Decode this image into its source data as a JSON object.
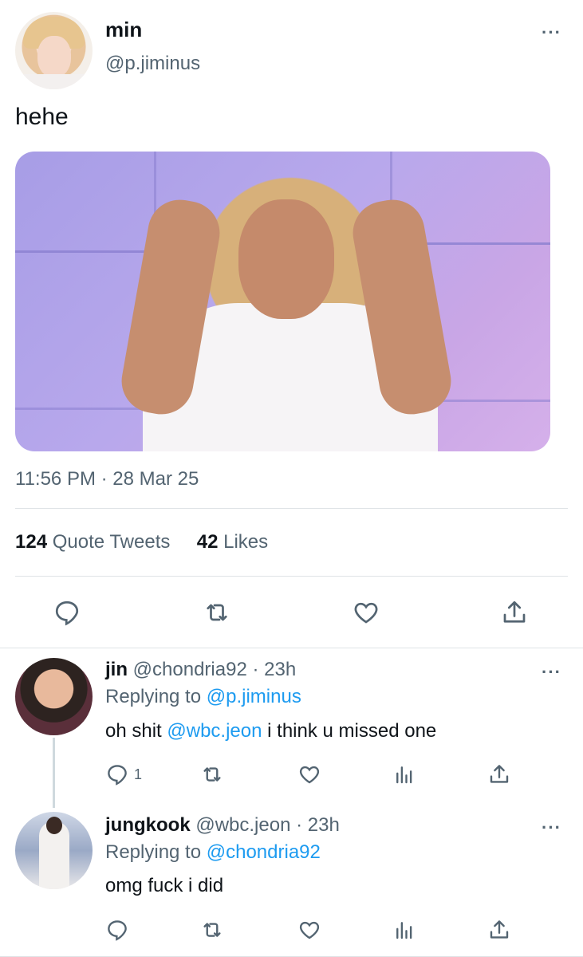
{
  "main_tweet": {
    "author_name": "min",
    "author_handle": "@p.jiminus",
    "text": "hehe",
    "timestamp": "11:56 PM · 28 Mar 25",
    "quote_tweets_count": "124",
    "quote_tweets_label": "Quote Tweets",
    "likes_count": "42",
    "likes_label": "Likes",
    "more_label": "···"
  },
  "replies": [
    {
      "author_name": "jin",
      "author_handle": "@chondria92",
      "time": "· 23h",
      "replying_to_prefix": "Replying to",
      "replying_to": "@p.jiminus",
      "text_before": "oh shit",
      "mention": "@wbc.jeon",
      "text_after": "i think u missed one",
      "reply_count": "1",
      "more_label": "···"
    },
    {
      "author_name": "jungkook",
      "author_handle": "@wbc.jeon",
      "time": "· 23h",
      "replying_to_prefix": "Replying to",
      "replying_to": "@chondria92",
      "text": "omg fuck i did",
      "more_label": "···"
    }
  ],
  "icons": [
    "reply-icon",
    "retweet-icon",
    "like-icon",
    "share-icon",
    "analytics-icon",
    "more-icon"
  ],
  "colors": {
    "text": "#0f1419",
    "secondary": "#536471",
    "link": "#1d9bf0",
    "divider": "#dfe3e6"
  }
}
